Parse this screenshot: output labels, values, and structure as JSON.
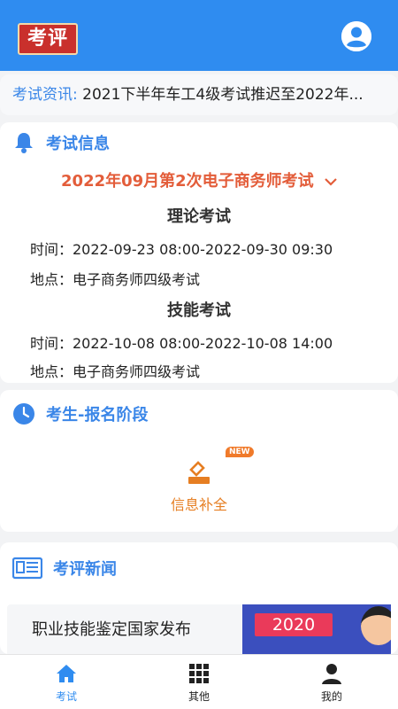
{
  "header": {
    "logo_text": "考评",
    "brand_color": "#2f8cf0"
  },
  "ticker": {
    "prefix": "考试资讯:",
    "text": "2021下半年车工4级考试推迟至2022年..."
  },
  "exam_info": {
    "title": "考试信息",
    "selected_exam": "2022年09月第2次电子商务师考试",
    "theory": {
      "heading": "理论考试",
      "time": "时间：2022-09-23 08:00-2022-09-30 09:30",
      "location": "地点：电子商务师四级考试"
    },
    "skill": {
      "heading": "技能考试",
      "time": "时间：2022-10-08 08:00-2022-10-08 14:00",
      "location": "地点：电子商务师四级考试"
    }
  },
  "stage": {
    "title": "考生-报名阶段",
    "service_label": "信息补全",
    "badge": "NEW"
  },
  "news": {
    "title": "考评新闻",
    "item_title": "职业技能鉴定国家发布",
    "thumb_year": "2020"
  },
  "tabbar": {
    "tabs": [
      {
        "label": "考试",
        "icon": "home-icon"
      },
      {
        "label": "其他",
        "icon": "grid-icon"
      },
      {
        "label": "我的",
        "icon": "person-icon"
      }
    ]
  }
}
